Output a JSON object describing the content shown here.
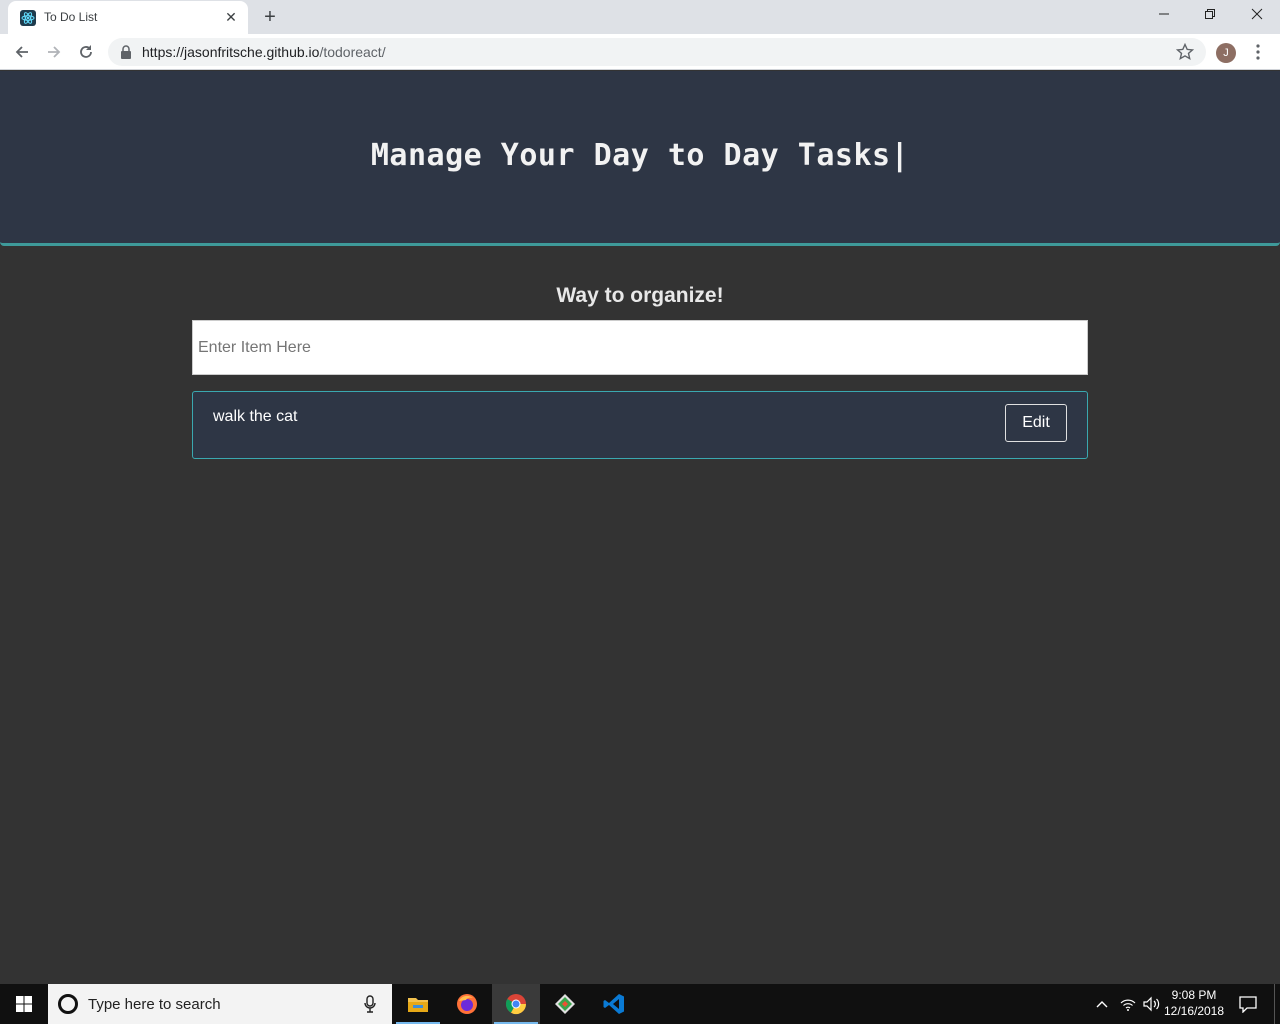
{
  "browser": {
    "tab_title": "To Do List",
    "url_host": "https://jasonfritsche.github.io",
    "url_path": "/todoreact/",
    "profile_initial": "J"
  },
  "page": {
    "hero_title": "Manage Your Day to Day Tasks|",
    "subheading": "Way to organize!",
    "input_placeholder": "Enter Item Here",
    "input_value": "",
    "todos": [
      {
        "text": "walk the cat",
        "edit_label": "Edit"
      }
    ]
  },
  "taskbar": {
    "search_placeholder": "Type here to search",
    "time": "9:08 PM",
    "date": "12/16/2018"
  },
  "colors": {
    "page_bg": "#333333",
    "hero_bg": "#2e3645",
    "accent_teal": "#3e9a9a",
    "card_border": "#3aa8b0"
  }
}
